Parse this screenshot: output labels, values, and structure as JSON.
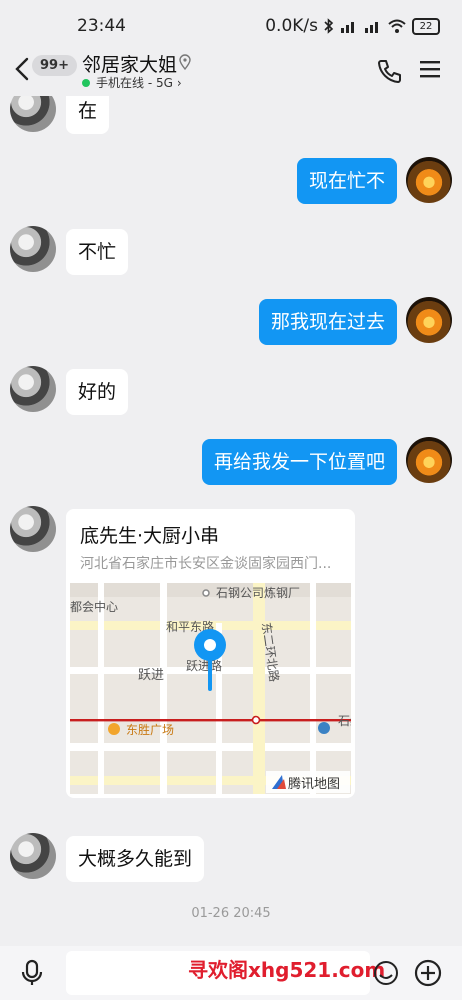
{
  "status": {
    "time": "23:44",
    "speed": "0.0K/s",
    "battery": "22"
  },
  "header": {
    "unread_badge": "99+",
    "title": "邻居家大姐",
    "status": "手机在线 - 5G"
  },
  "messages": [
    {
      "side": "in",
      "text": "在"
    },
    {
      "side": "out",
      "text": "现在忙不"
    },
    {
      "side": "in",
      "text": "不忙"
    },
    {
      "side": "out",
      "text": "那我现在过去"
    },
    {
      "side": "in",
      "text": "好的"
    },
    {
      "side": "out",
      "text": "再给我发一下位置吧"
    },
    {
      "side": "in",
      "text": "大概多久能到"
    }
  ],
  "location_card": {
    "title": "底先生·大厨小串",
    "address": "河北省石家庄市长安区金谈固家园西门...",
    "map_labels": [
      "石钢公司炼钢厂",
      "都会中心",
      "和平东路",
      "东二环北路",
      "跃进",
      "跃进路",
      "东胜广场",
      "石纪"
    ],
    "map_brand": "腾讯地图"
  },
  "timestamp": "01-26 20:45",
  "watermark": "寻欢阁xhg521.com",
  "colors": {
    "accent": "#1296f3",
    "online": "#22c55e",
    "watermark": "#e01e2e"
  }
}
